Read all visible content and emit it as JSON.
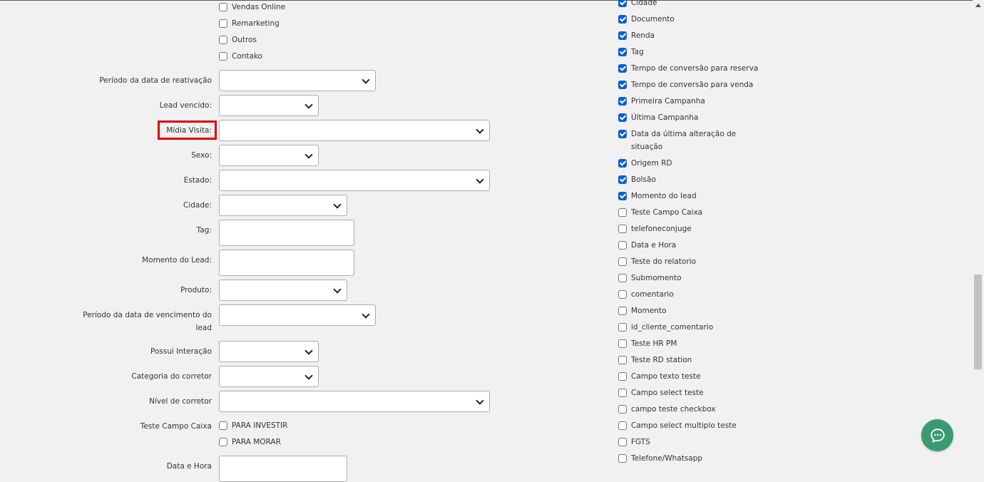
{
  "left_options_top": [
    {
      "label": "Vendas Online",
      "checked": false
    },
    {
      "label": "Remarketing",
      "checked": false
    },
    {
      "label": "Outros",
      "checked": false
    },
    {
      "label": "Contako",
      "checked": false
    }
  ],
  "fields": {
    "periodo_reativacao": "Período da data de reativação",
    "lead_vencido": "Lead vencido:",
    "midia_visita": "Mídia Visita:",
    "sexo": "Sexo:",
    "estado": "Estado:",
    "cidade": "Cidade:",
    "tag": "Tag:",
    "momento_lead": "Momento do Lead:",
    "produto": "Produto:",
    "periodo_vencimento_1": "Período da data de vencimento do",
    "periodo_vencimento_2": "lead",
    "possui_interacao": "Possui Interação",
    "categoria_corretor": "Categoria do corretor",
    "nivel_corretor": "Nível de corretor",
    "teste_campo_caixa": "Teste Campo Caixa",
    "data_hora": "Data e Hora"
  },
  "teste_campo_caixa_options": [
    {
      "label": "PARA INVESTIR",
      "checked": false
    },
    {
      "label": "PARA MORAR",
      "checked": false
    }
  ],
  "right_options": [
    {
      "label": "Cidade",
      "checked": true
    },
    {
      "label": "Documento",
      "checked": true
    },
    {
      "label": "Renda",
      "checked": true
    },
    {
      "label": "Tag",
      "checked": true
    },
    {
      "label": "Tempo de conversão para reserva",
      "checked": true
    },
    {
      "label": "Tempo de conversão para venda",
      "checked": true
    },
    {
      "label": "Primeira Campanha",
      "checked": true
    },
    {
      "label": "Última Campanha",
      "checked": true
    },
    {
      "label": "Data da última alteração de",
      "label2": "situação",
      "checked": true
    },
    {
      "label": "Origem RD",
      "checked": true
    },
    {
      "label": "Bolsão",
      "checked": true
    },
    {
      "label": "Momento do lead",
      "checked": true
    },
    {
      "label": "Teste Campo Caixa",
      "checked": false
    },
    {
      "label": "telefoneconjuge",
      "checked": false
    },
    {
      "label": "Data e Hora",
      "checked": false
    },
    {
      "label": "Teste do relatorio",
      "checked": false
    },
    {
      "label": "Submomento",
      "checked": false
    },
    {
      "label": "comentario",
      "checked": false
    },
    {
      "label": "Momento",
      "checked": false
    },
    {
      "label": "id_cliente_comentario",
      "checked": false
    },
    {
      "label": "Teste HR PM",
      "checked": false
    },
    {
      "label": "Teste RD station",
      "checked": false
    },
    {
      "label": "Campo texto teste",
      "checked": false
    },
    {
      "label": "Campo select teste",
      "checked": false
    },
    {
      "label": "campo teste checkbox",
      "checked": false
    },
    {
      "label": "Campo select multiplo teste",
      "checked": false
    },
    {
      "label": "FGTS",
      "checked": false
    },
    {
      "label": "Telefone/Whatsapp",
      "checked": false
    }
  ],
  "colors": {
    "checkbox_checked": "#0b5ed7",
    "highlight": "#e00000",
    "chat_button": "#3c9a72"
  },
  "icons": {
    "chat": "chat-bubble-icon",
    "dropdown": "chevron-down-icon"
  }
}
